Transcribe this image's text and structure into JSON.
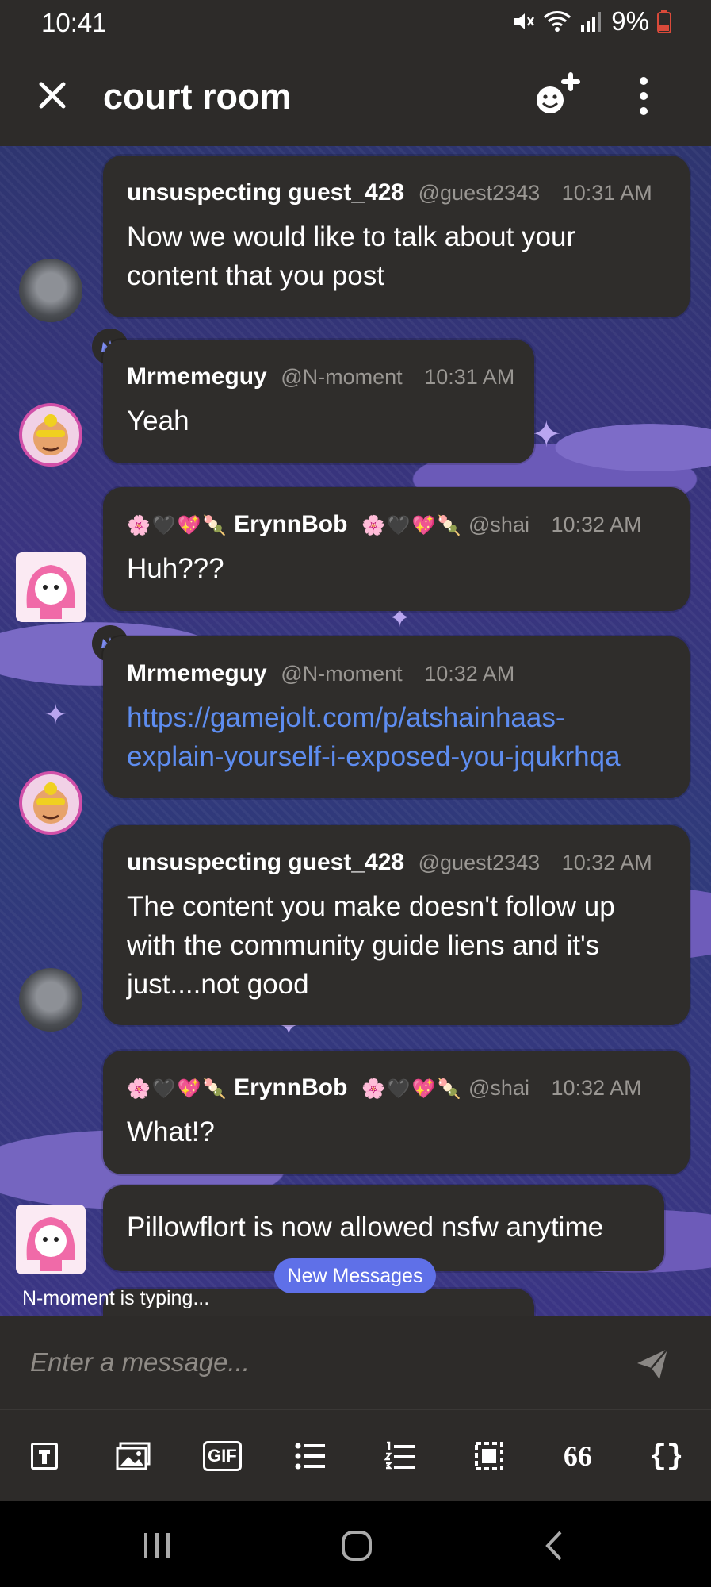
{
  "status": {
    "time": "10:41",
    "battery": "9%"
  },
  "header": {
    "title": "court room"
  },
  "messages": [
    {
      "name": "unsuspecting guest_428",
      "handle": "@guest2343",
      "time": "10:31 AM",
      "lines": [
        "Now we would like to talk about your",
        "content that you post"
      ]
    },
    {
      "name": "Mrmemeguy",
      "handle": "@N-moment",
      "time": "10:31 AM",
      "lines": [
        "Yeah"
      ]
    },
    {
      "name": "ErynnBob",
      "handle": "@shai",
      "time": "10:32 AM",
      "lines": [
        "Huh???"
      ]
    },
    {
      "name": "Mrmemeguy",
      "handle": "@N-moment",
      "time": "10:32 AM",
      "lines": [
        "https://gamejolt.com/p/atshainhaas-",
        "explain-yourself-i-exposed-you-jqukrhqa"
      ]
    },
    {
      "name": "unsuspecting guest_428",
      "handle": "@guest2343",
      "time": "10:32 AM",
      "lines": [
        "The content you make doesn't follow up",
        "with the community guide liens and it's",
        "just....not good"
      ]
    },
    {
      "name": "ErynnBob",
      "handle": "@shai",
      "time": "10:32 AM",
      "lines": [
        "What!?"
      ]
    },
    {
      "lines": [
        "Pillowflort is now allowed nsfw anytime"
      ]
    }
  ],
  "emoji_flair": [
    "🌸",
    "🖤",
    "💖",
    "🍡"
  ],
  "new_messages": "New Messages",
  "typing": "N-moment is typing...",
  "composer": {
    "placeholder": "Enter a message..."
  },
  "toolbar": {
    "gif": "GIF",
    "quote": "66",
    "code": "{}"
  },
  "icons": {
    "close": "close-icon",
    "add_member": "add-member-icon",
    "more": "more-vert-icon",
    "send": "send-icon",
    "crown": "crown-icon"
  },
  "colors": {
    "accent": "#5f70e8",
    "link": "#5e8df0",
    "bubble": "#2f2d2b",
    "chrome": "#2d2b29"
  }
}
